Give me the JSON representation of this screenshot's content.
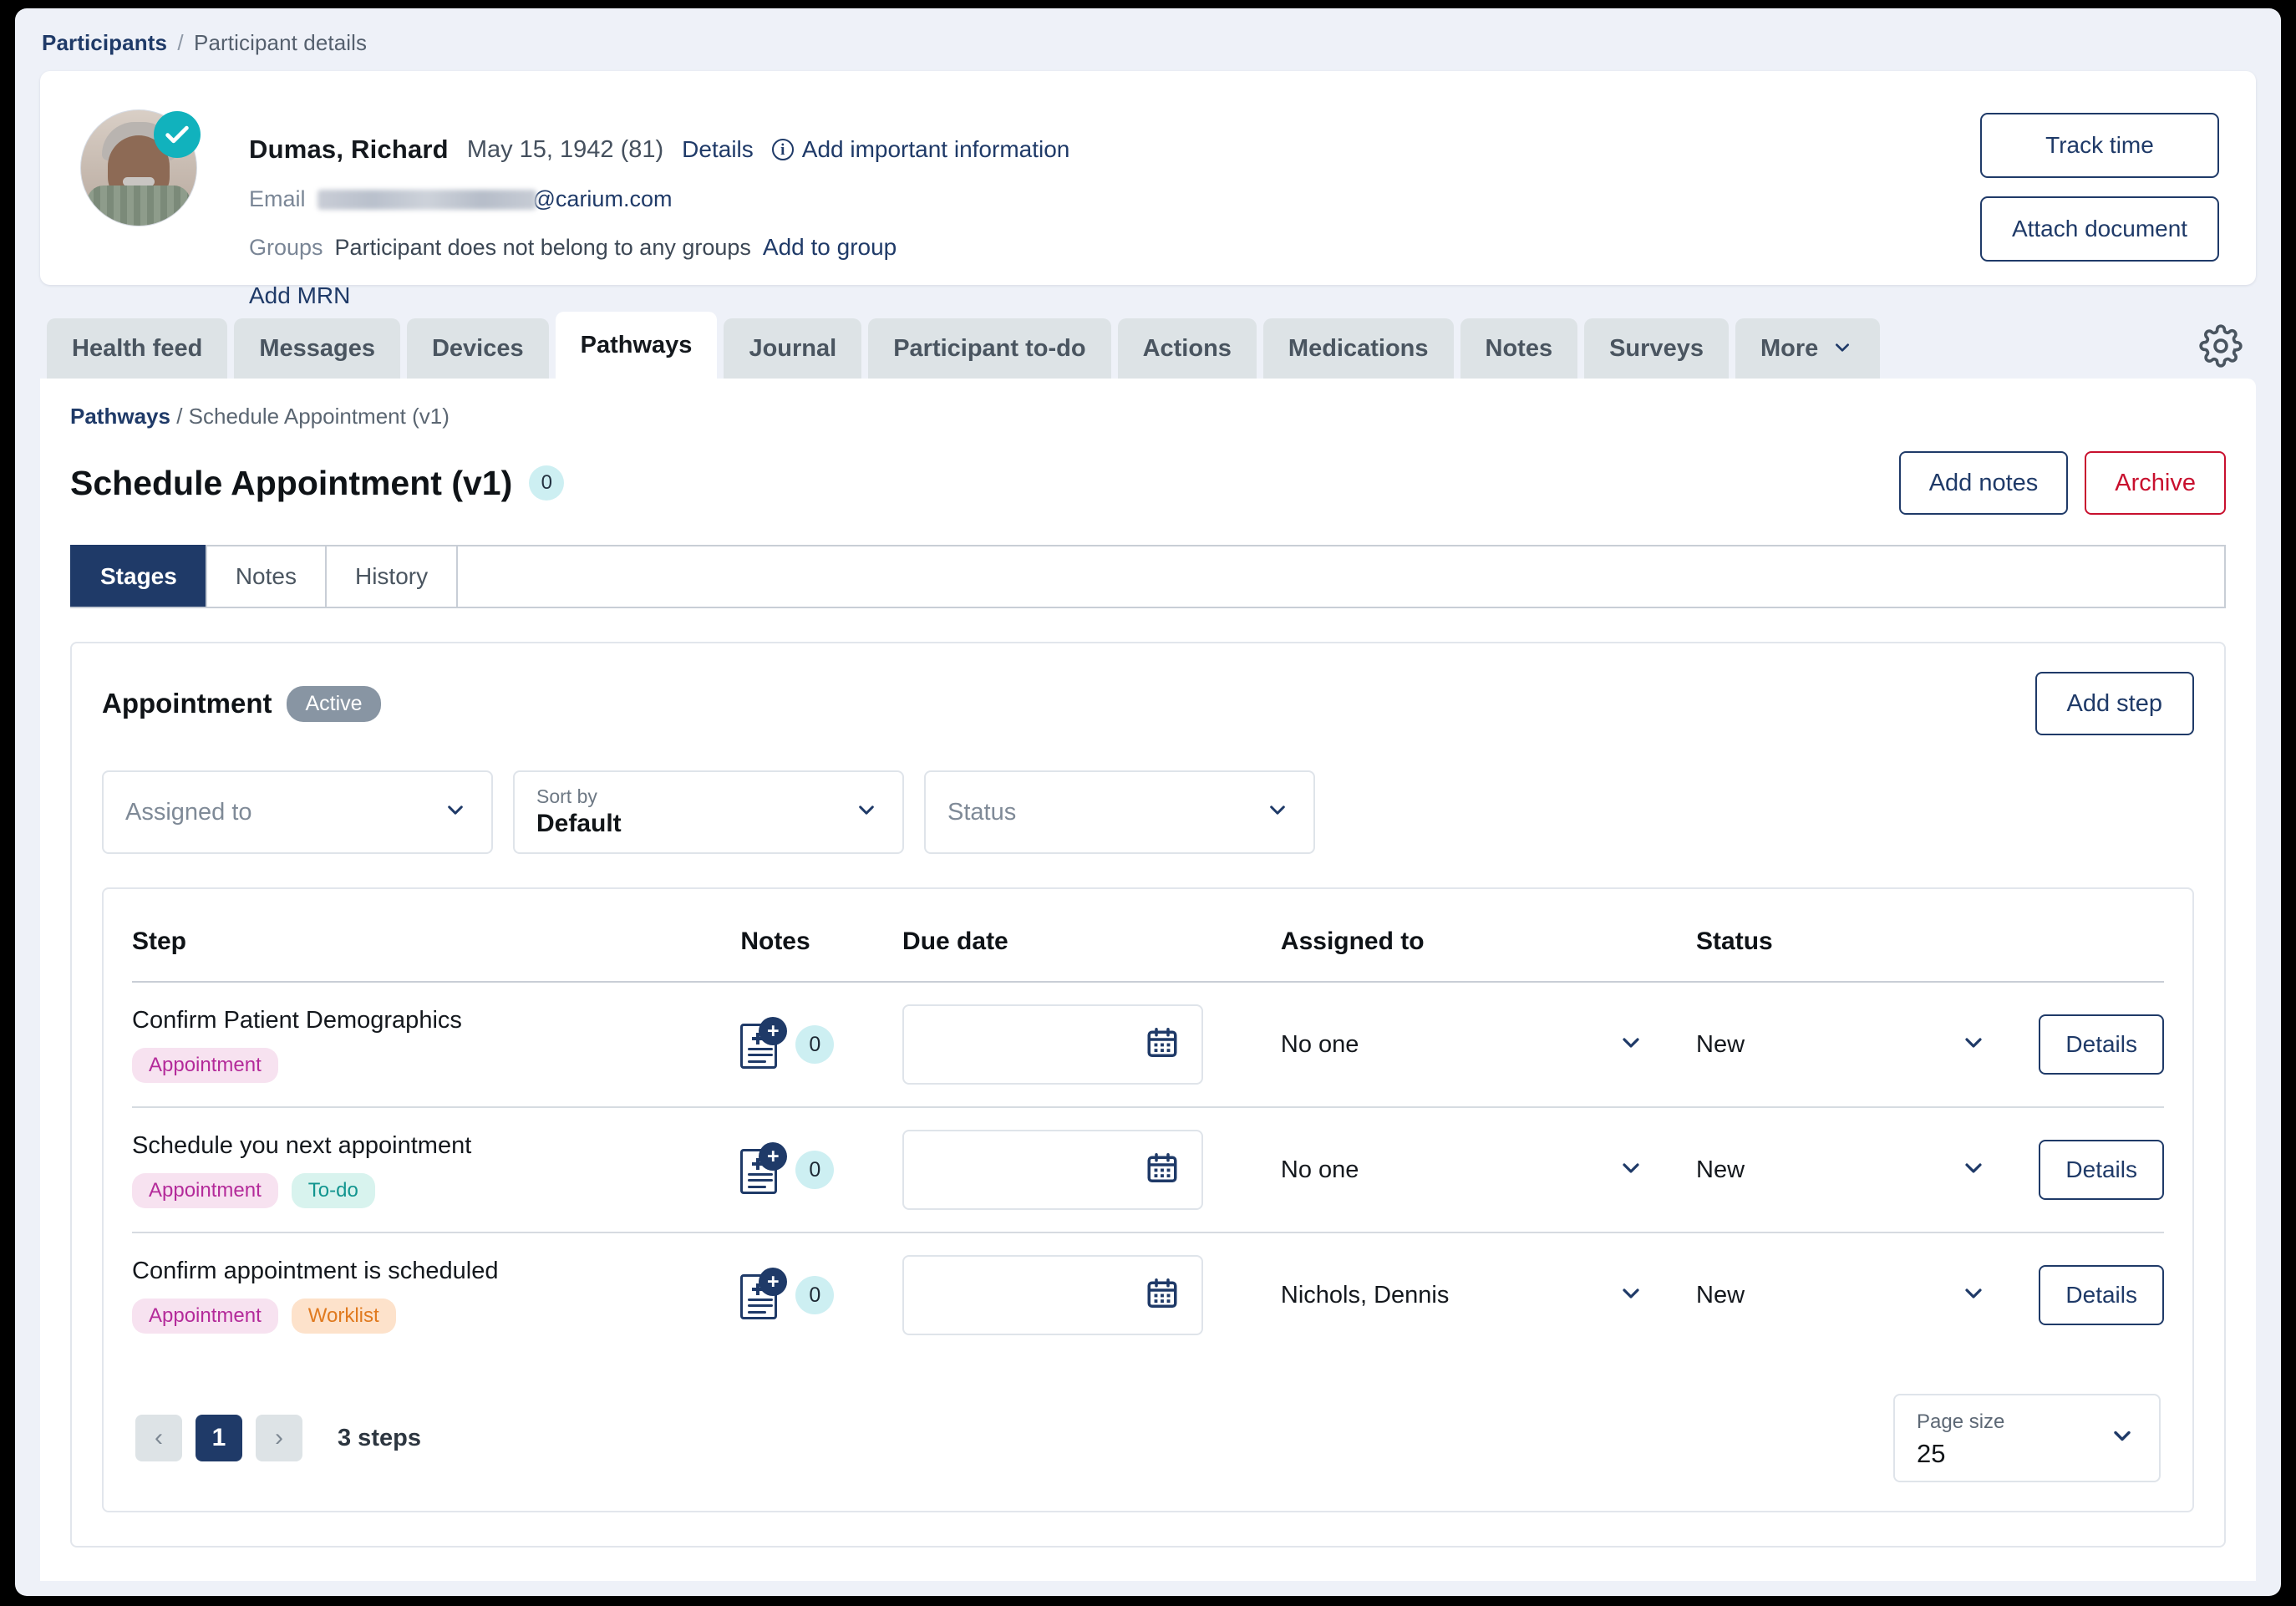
{
  "breadcrumb_top": {
    "root": "Participants",
    "sep": "/",
    "current": "Participant details"
  },
  "patient": {
    "name": "Dumas, Richard",
    "dob": "May 15, 1942 (81)",
    "details_link": "Details",
    "add_info_link": "Add important information",
    "email_label": "Email",
    "email_domain": "@carium.com",
    "groups_label": "Groups",
    "groups_value": "Participant does not belong to any groups",
    "add_to_group_link": "Add to group",
    "add_mrn_link": "Add MRN",
    "verified_icon": "check-circle-icon"
  },
  "header_actions": {
    "track_time": "Track time",
    "attach_document": "Attach document"
  },
  "tabs": [
    {
      "label": "Health feed",
      "active": false
    },
    {
      "label": "Messages",
      "active": false
    },
    {
      "label": "Devices",
      "active": false
    },
    {
      "label": "Pathways",
      "active": true
    },
    {
      "label": "Journal",
      "active": false
    },
    {
      "label": "Participant to-do",
      "active": false
    },
    {
      "label": "Actions",
      "active": false
    },
    {
      "label": "Medications",
      "active": false
    },
    {
      "label": "Notes",
      "active": false
    },
    {
      "label": "Surveys",
      "active": false
    },
    {
      "label": "More",
      "active": false,
      "chevron": true
    }
  ],
  "settings_icon": "gear-icon",
  "panel": {
    "breadcrumb": {
      "root": "Pathways",
      "sep": "/",
      "current": "Schedule Appointment (v1)"
    },
    "title": "Schedule Appointment (v1)",
    "title_count": "0",
    "actions": {
      "add_notes": "Add notes",
      "archive": "Archive"
    },
    "subtabs": [
      {
        "label": "Stages",
        "active": true
      },
      {
        "label": "Notes",
        "active": false
      },
      {
        "label": "History",
        "active": false
      }
    ]
  },
  "stage": {
    "name": "Appointment",
    "status_pill": "Active",
    "add_step_label": "Add step",
    "filters": [
      {
        "name": "assigned-to",
        "label": "",
        "placeholder": "Assigned to",
        "value": ""
      },
      {
        "name": "sort-by",
        "label": "Sort by",
        "placeholder": "",
        "value": "Default"
      },
      {
        "name": "status",
        "label": "",
        "placeholder": "Status",
        "value": ""
      }
    ]
  },
  "table": {
    "columns": [
      "Step",
      "Notes",
      "Due date",
      "Assigned to",
      "Status",
      ""
    ],
    "rows": [
      {
        "step": "Confirm Patient Demographics",
        "tags": [
          {
            "text": "Appointment",
            "kind": "appointment"
          }
        ],
        "notes_count": "0",
        "due_date": "",
        "assigned_to": "No one",
        "status": "New",
        "details_label": "Details"
      },
      {
        "step": "Schedule you next appointment",
        "tags": [
          {
            "text": "Appointment",
            "kind": "appointment"
          },
          {
            "text": "To-do",
            "kind": "todo"
          }
        ],
        "notes_count": "0",
        "due_date": "",
        "assigned_to": "No one",
        "status": "New",
        "details_label": "Details"
      },
      {
        "step": "Confirm appointment is scheduled",
        "tags": [
          {
            "text": "Appointment",
            "kind": "appointment"
          },
          {
            "text": "Worklist",
            "kind": "worklist"
          }
        ],
        "notes_count": "0",
        "due_date": "",
        "assigned_to": "Nichols, Dennis",
        "status": "New",
        "details_label": "Details"
      }
    ]
  },
  "pager": {
    "prev": "‹",
    "pages": [
      "1"
    ],
    "next": "›",
    "count_label": "3 steps",
    "page_size_label": "Page size",
    "page_size_value": "25"
  },
  "colors": {
    "navy": "#1f3a68",
    "red": "#c8102e",
    "teal": "#11b2bd",
    "badge_bg": "#cdeff2",
    "tab_inactive": "#dde3e6",
    "pill_gray": "#8895a3",
    "tag_appointment": "#b42b9a",
    "tag_todo": "#12958f",
    "tag_worklist": "#e07a1f"
  }
}
